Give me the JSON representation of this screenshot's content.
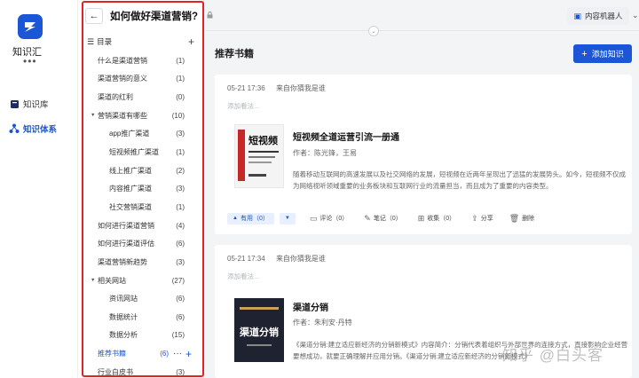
{
  "app": {
    "name": "知识汇",
    "more": "•••"
  },
  "rail_nav": [
    {
      "label": "知识库",
      "icon": "book-icon",
      "active": false
    },
    {
      "label": "知识体系",
      "icon": "network-icon",
      "active": true
    }
  ],
  "doc": {
    "back": "←",
    "title": "如何做好渠道营销?"
  },
  "toc": {
    "title": "目录",
    "items": [
      {
        "label": "什么是渠道营销",
        "count": "(1)",
        "level": 1
      },
      {
        "label": "渠道营销的意义",
        "count": "(1)",
        "level": 1
      },
      {
        "label": "渠道的红利",
        "count": "(0)",
        "level": 1
      },
      {
        "label": "营销渠道有哪些",
        "count": "(10)",
        "level": 1,
        "expanded": true
      },
      {
        "label": "app推广渠道",
        "count": "(3)",
        "level": 2
      },
      {
        "label": "短视频推广渠道",
        "count": "(1)",
        "level": 2
      },
      {
        "label": "线上推广渠道",
        "count": "(2)",
        "level": 2
      },
      {
        "label": "内容推广渠道",
        "count": "(3)",
        "level": 2
      },
      {
        "label": "社交营销渠道",
        "count": "(1)",
        "level": 2
      },
      {
        "label": "如何进行渠道营销",
        "count": "(4)",
        "level": 1
      },
      {
        "label": "如何进行渠道评估",
        "count": "(6)",
        "level": 1
      },
      {
        "label": "渠道营销新趋势",
        "count": "(3)",
        "level": 1
      },
      {
        "label": "相关网站",
        "count": "(27)",
        "level": 1,
        "expanded": true
      },
      {
        "label": "资讯网站",
        "count": "(6)",
        "level": 2
      },
      {
        "label": "数据统计",
        "count": "(6)",
        "level": 2
      },
      {
        "label": "数据分析",
        "count": "(15)",
        "level": 2
      },
      {
        "label": "推荐书籍",
        "count": "(6)",
        "level": 1,
        "active": true
      },
      {
        "label": "行业白皮书",
        "count": "(3)",
        "level": 1
      }
    ]
  },
  "topbar": {
    "robot_label": "内容机器人"
  },
  "main": {
    "section_title": "推荐书籍",
    "add_label": "添加知识",
    "cards": [
      {
        "time": "05-21 17:36",
        "source": "来自你猜我是谁",
        "note_placeholder": "添加看法...",
        "title": "短视频全道运营引流一册通",
        "author": "作者：陈光锋，王易",
        "desc": "随着移动互联网的高速发展以及社交网络的发展，短视频在近两年呈现出了迅猛的发展势头。如今，短视频不仅成为网络视听领域重要的业务板块和互联网行业的流量担当，而且成为了重要的内容类型。",
        "cover_text": "短视频"
      },
      {
        "time": "05-21 17:34",
        "source": "来自你猜我是谁",
        "note_placeholder": "添加看法...",
        "title": "渠道分销",
        "author": "作者：朱利安·丹特",
        "desc": "《渠道分销:建立适应新经济的分销新模式》内容简介：分销代表着组织与外部世界的连接方式，直接影响企业经营要想成功，就要正确理解并应用分销。《渠道分销:建立适应新经济的分销新模式》",
        "cover_text": "渠道分销"
      }
    ],
    "actions": {
      "useful": "有用（0）",
      "comment": "评论（0）",
      "note": "笔记（0）",
      "collect": "收集（0）",
      "share": "分享",
      "delete": "删除"
    }
  },
  "watermark": "知乎 @白头客",
  "colors": {
    "accent": "#1a56d6",
    "frame": "#e02424"
  }
}
